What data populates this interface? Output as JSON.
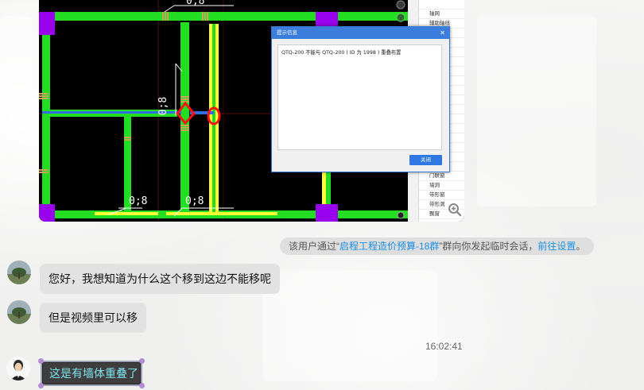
{
  "screenshot": {
    "dimension_labels": [
      "0;8",
      "0;8",
      "0;8",
      "0;8"
    ],
    "side_panel_items": [
      "轴网",
      "辅助轴线",
      "门联窗",
      "墙洞",
      "带形窗",
      "带形洞",
      "飘窗"
    ],
    "dialog": {
      "title": "提示信息",
      "message": "QTQ-200 不能与 QTQ-200 ( ID 为 1998 ) 重叠布置",
      "ok_label": "关闭"
    }
  },
  "notice": {
    "prefix": "该用户通过“",
    "group_link": "启程工程造价预算-18群",
    "middle": "”群向你发起临时会话，",
    "settings_link": "前往设置",
    "suffix": "。"
  },
  "messages": [
    {
      "sender": "other",
      "text": "您好，我想知道为什么这个移到这边不能移呢"
    },
    {
      "sender": "other",
      "text": "但是视频里可以移"
    },
    {
      "sender": "self",
      "text": "这是有墙体重叠了"
    }
  ],
  "timestamp": "16:02:41",
  "colors": {
    "accent_link": "#1a8fe6",
    "beam_green": "#22dd22",
    "column_purple": "#9900ee",
    "wall_yellow": "#ffff33",
    "dialog_blue": "#3b7ddd"
  }
}
